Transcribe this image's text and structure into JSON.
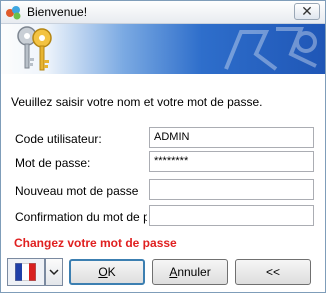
{
  "window": {
    "title": "Bienvenue!",
    "close_glyph": "✕"
  },
  "prompt": "Veuillez saisir votre nom et votre mot de passe.",
  "fields": [
    {
      "label": "Code utilisateur:",
      "value": "ADMIN"
    },
    {
      "label": "Mot de passe:",
      "value": "********"
    },
    {
      "label": "Nouveau mot de passe",
      "value": ""
    },
    {
      "label": "Confirmation du mot de p",
      "value": ""
    }
  ],
  "change_password_text": "Changez votre mot de passe",
  "language": {
    "flag": "fr-flag-icon"
  },
  "buttons": {
    "ok": {
      "first": "O",
      "rest": "K"
    },
    "cancel": {
      "first": "A",
      "rest": "nnuler"
    },
    "collapse": "<<"
  },
  "colors": {
    "warning": "#e02020",
    "banner_blue": "#1f56b6",
    "default_button_border": "#3c7fb1"
  }
}
